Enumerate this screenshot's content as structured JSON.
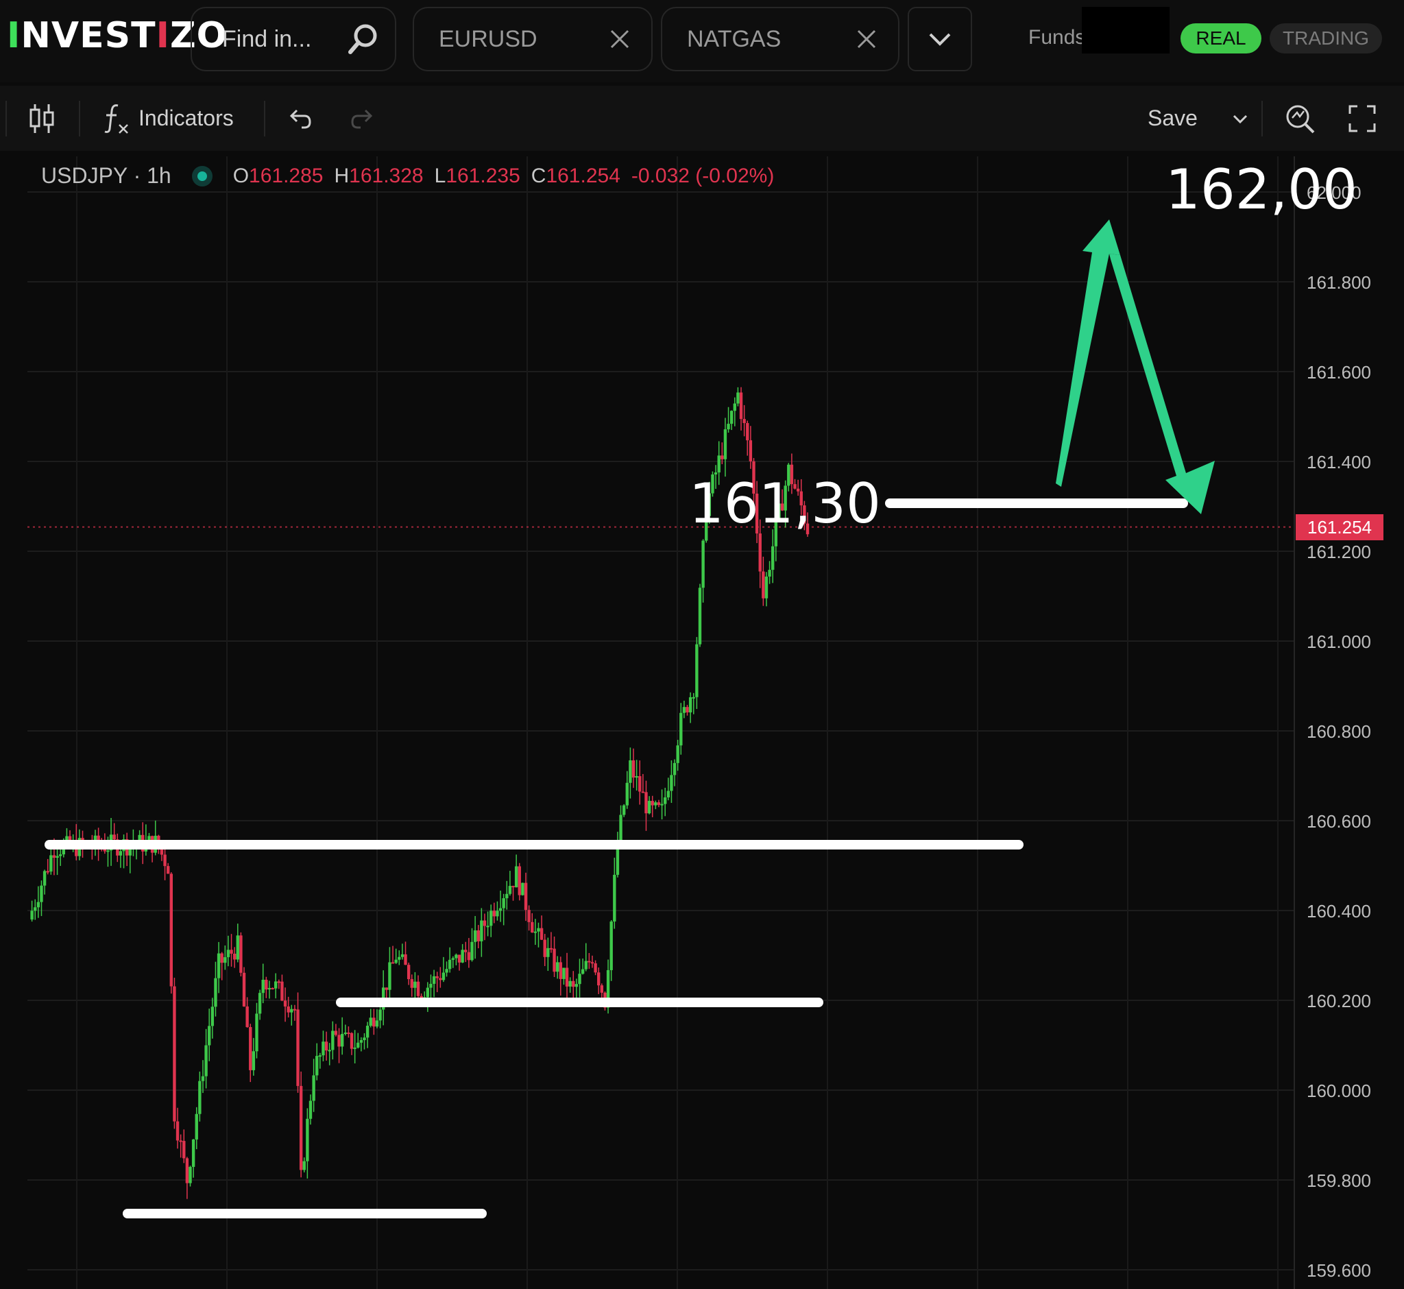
{
  "header": {
    "logo": {
      "i": "I",
      "nvest": "NVEST",
      "dagger": "I",
      "zo": "ZO"
    },
    "search": {
      "placeholder": "Find in..."
    },
    "tabs": [
      {
        "label": "EURUSD"
      },
      {
        "label": "NATGAS"
      }
    ],
    "funds_label": "Funds",
    "mode_real": "REAL",
    "mode_trading": "TRADING"
  },
  "toolbar": {
    "indicators_label": "Indicators",
    "save_label": "Save"
  },
  "legend": {
    "symbol": "USDJPY · 1h",
    "open_label": "O",
    "open": "161.285",
    "high_label": "H",
    "high": "161.328",
    "low_label": "L",
    "low": "161.235",
    "close_label": "C",
    "close": "161.254",
    "change": "-0.032 (-0.02%)"
  },
  "price_scale": {
    "labels": [
      "62.000",
      "161.800",
      "161.600",
      "161.400",
      "161.200",
      "161.000",
      "160.800",
      "160.600",
      "160.400",
      "160.200",
      "160.000",
      "159.800",
      "159.600"
    ],
    "current_price": "161.254"
  },
  "annotations": {
    "level_mid": "161,30",
    "level_top": "162,00"
  },
  "colors": {
    "up": "#3ec94a",
    "down": "#e0344f",
    "arrow": "#2fd18a",
    "annotation_line": "#ffffff"
  }
}
